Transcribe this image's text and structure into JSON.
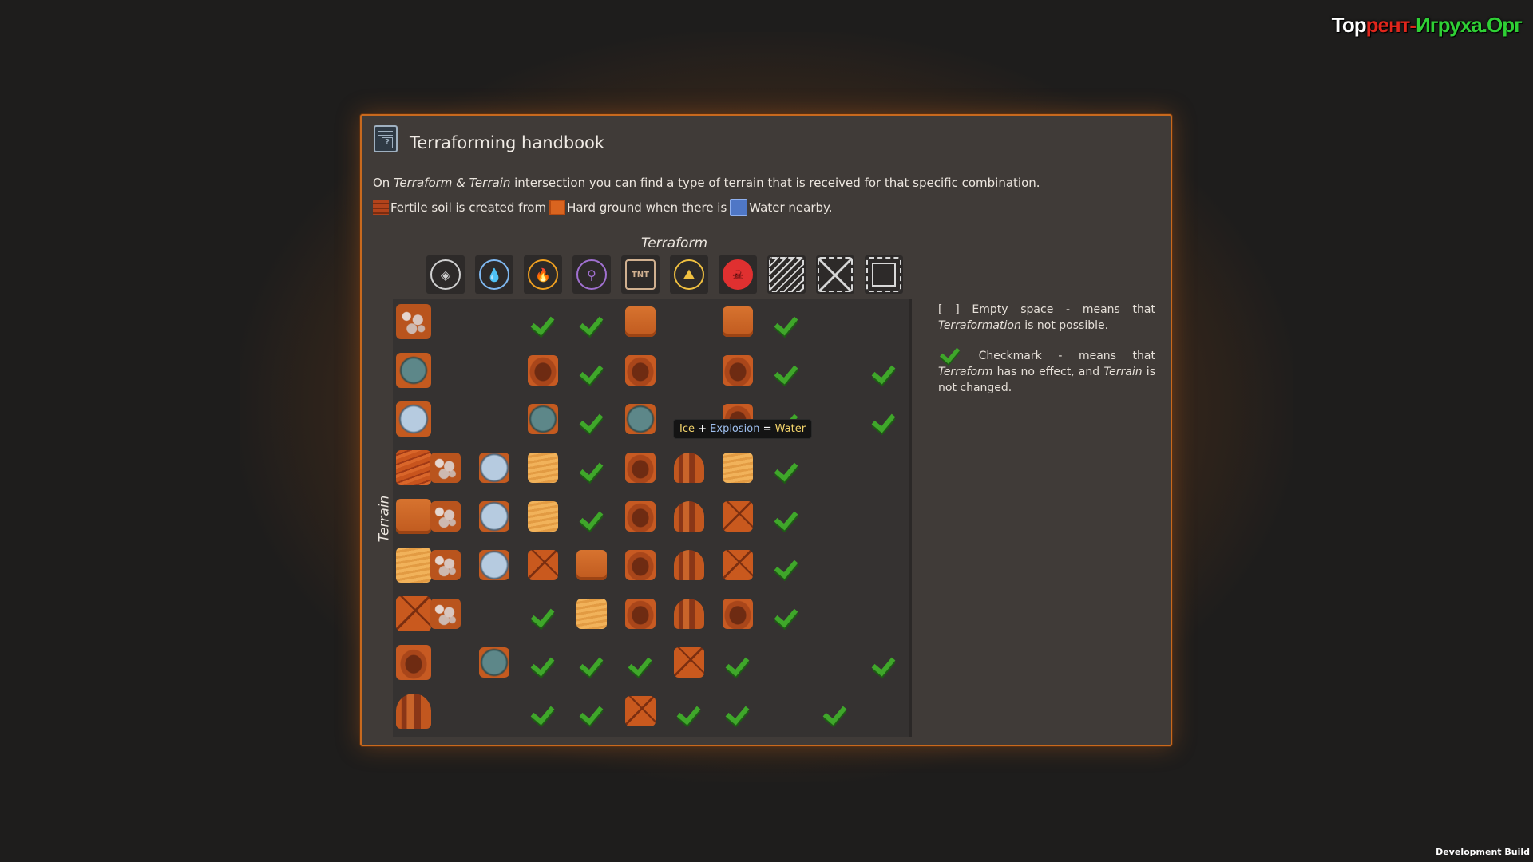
{
  "watermark": {
    "part1": "Тор",
    "part2": "рент-",
    "part3": "Игруха.Орг"
  },
  "dev_build": "Development Build",
  "window": {
    "title": "Terraforming handbook",
    "intro_prefix": "On ",
    "intro_italic": "Terraform & Terrain",
    "intro_suffix": " intersection you can find a type of terrain that is received for that specific combination.",
    "legend": {
      "fertile": "Fertile soil is created from",
      "hard": "Hard ground when there is",
      "water": "Water nearby."
    }
  },
  "grid": {
    "col_label": "Terraform",
    "row_label": "Terrain",
    "columns": [
      {
        "icon": "crystal-icon",
        "color": "#d0d0d0"
      },
      {
        "icon": "water-drop-icon",
        "color": "#7fb8f0"
      },
      {
        "icon": "fire-icon",
        "color": "#f0a020"
      },
      {
        "icon": "shovel-icon",
        "color": "#a070d0"
      },
      {
        "icon": "tnt-icon",
        "color": "#d0b090"
      },
      {
        "icon": "landslide-icon",
        "color": "#f0c040"
      },
      {
        "icon": "skull-icon",
        "color": "#e03030"
      },
      {
        "icon": "hatched-area-icon",
        "color": "#d8d8d8"
      },
      {
        "icon": "mountain-icon",
        "color": "#d8d8d8"
      },
      {
        "icon": "boulder-outline-icon",
        "color": "#d8d8d8"
      }
    ],
    "rows": [
      {
        "terrain": "rocky",
        "cells": [
          "",
          "",
          "check",
          "check",
          "hard",
          "",
          "hard",
          "check",
          "",
          ""
        ]
      },
      {
        "terrain": "waterstone",
        "cells": [
          "",
          "",
          "clay",
          "check",
          "clay",
          "",
          "clay",
          "check",
          "",
          "check"
        ]
      },
      {
        "terrain": "ice",
        "cells": [
          "",
          "",
          "waterstone",
          "check",
          "waterstone",
          "",
          "clay",
          "check",
          "",
          "check"
        ]
      },
      {
        "terrain": "fertile",
        "cells": [
          "rocky",
          "ice",
          "sand",
          "check",
          "clay",
          "pillar",
          "sand",
          "check",
          "",
          ""
        ]
      },
      {
        "terrain": "hard",
        "cells": [
          "rocky",
          "ice",
          "sand",
          "check",
          "clay",
          "pillar",
          "crack",
          "check",
          "",
          ""
        ]
      },
      {
        "terrain": "sand",
        "cells": [
          "rocky",
          "ice",
          "crack",
          "hard",
          "clay",
          "pillar",
          "crack",
          "check",
          "",
          ""
        ]
      },
      {
        "terrain": "crack",
        "cells": [
          "rocky",
          "",
          "check",
          "sand",
          "clay",
          "pillar",
          "clay",
          "check",
          "",
          ""
        ]
      },
      {
        "terrain": "clay",
        "cells": [
          "",
          "waterstone",
          "check",
          "check",
          "check",
          "crack",
          "check",
          "",
          "",
          "check"
        ]
      },
      {
        "terrain": "pillar",
        "cells": [
          "",
          "",
          "check",
          "check",
          "crack",
          "check",
          "check",
          "",
          "check",
          ""
        ]
      }
    ]
  },
  "tooltip": {
    "a": "Ice",
    "plus": " + ",
    "b": "Explosion",
    "eq": " = ",
    "c": "Water"
  },
  "side_notes": {
    "empty_prefix": "[ ] Empty space - means that ",
    "empty_italic": "Terraformation",
    "empty_suffix": " is not possible.",
    "check_prefix": " Checkmark - means that ",
    "check_italic1": "Terraform",
    "check_mid": " has no effect, and ",
    "check_italic2": "Terrain",
    "check_suffix": " is not changed."
  }
}
